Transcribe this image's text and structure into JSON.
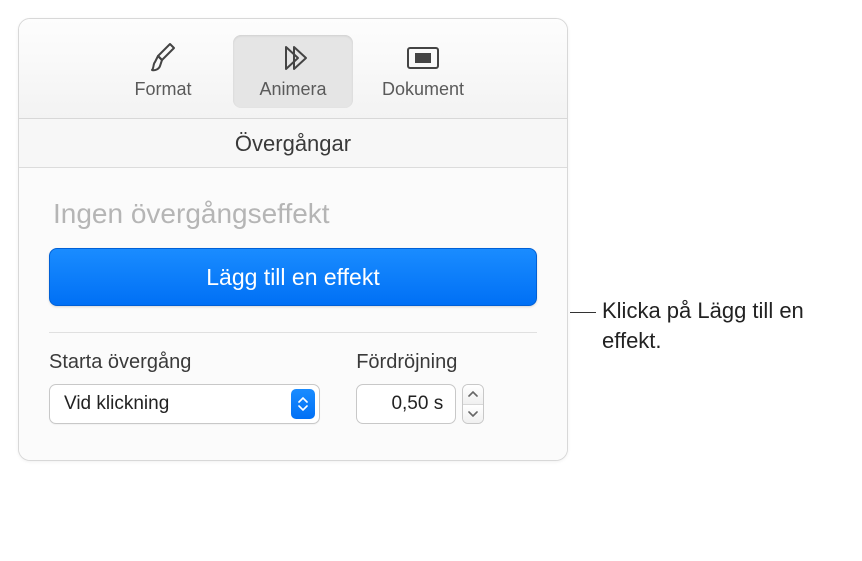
{
  "toolbar": {
    "format": "Format",
    "animate": "Animera",
    "document": "Dokument"
  },
  "section": {
    "title": "Övergångar"
  },
  "effect": {
    "none_label": "Ingen övergångseffekt",
    "add_button": "Lägg till en effekt"
  },
  "options": {
    "start_label": "Starta övergång",
    "start_value": "Vid klickning",
    "delay_label": "Fördröjning",
    "delay_value": "0,50 s"
  },
  "callout": {
    "text": "Klicka på Lägg till en effekt."
  }
}
